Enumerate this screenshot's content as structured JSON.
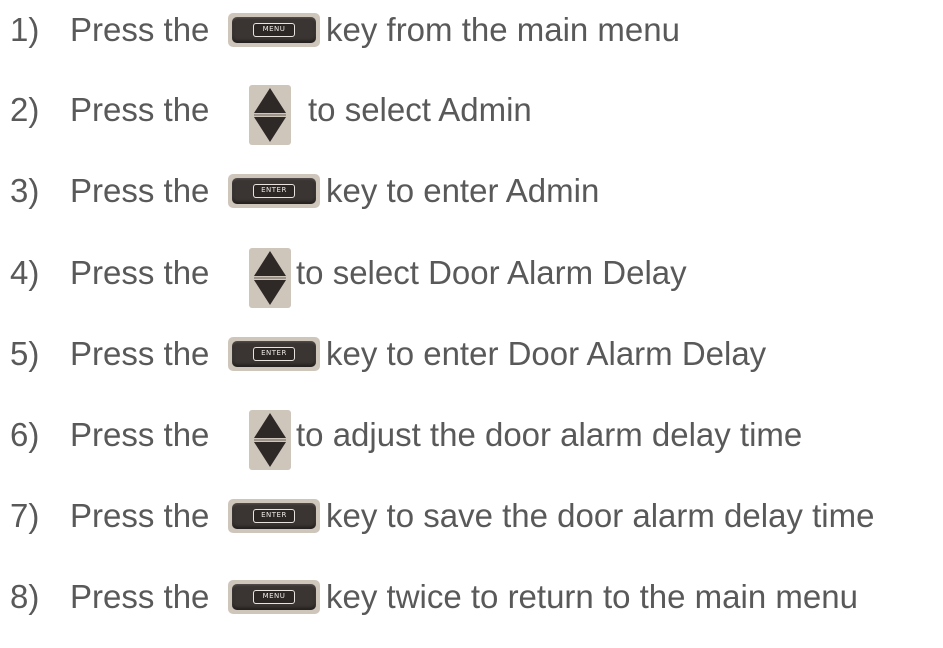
{
  "icons": {
    "menu_key": "menu-key-icon",
    "enter_key": "enter-key-icon",
    "updown_arrows": "up-down-arrow-icon",
    "menu_key_text": "MENU",
    "enter_key_text": "ENTER"
  },
  "colors": {
    "text": "#595959",
    "key_bg": "#cfc6bb",
    "key_face": "#3a3432"
  },
  "steps": [
    {
      "num": "1)",
      "lead": "Press the",
      "tail": "key from the main menu"
    },
    {
      "num": "2)",
      "lead": "Press the",
      "tail": "to select Admin"
    },
    {
      "num": "3)",
      "lead": "Press the",
      "tail": "key to enter Admin"
    },
    {
      "num": "4)",
      "lead": "Press the",
      "tail": "to select Door Alarm Delay"
    },
    {
      "num": "5)",
      "lead": "Press the",
      "tail": "key to enter Door Alarm Delay"
    },
    {
      "num": "6)",
      "lead": "Press the",
      "tail": "to adjust the door alarm delay time"
    },
    {
      "num": "7)",
      "lead": "Press the",
      "tail": "key to save the door alarm delay time"
    },
    {
      "num": "8)",
      "lead": "Press the",
      "tail": "key twice to return to the main menu"
    }
  ]
}
